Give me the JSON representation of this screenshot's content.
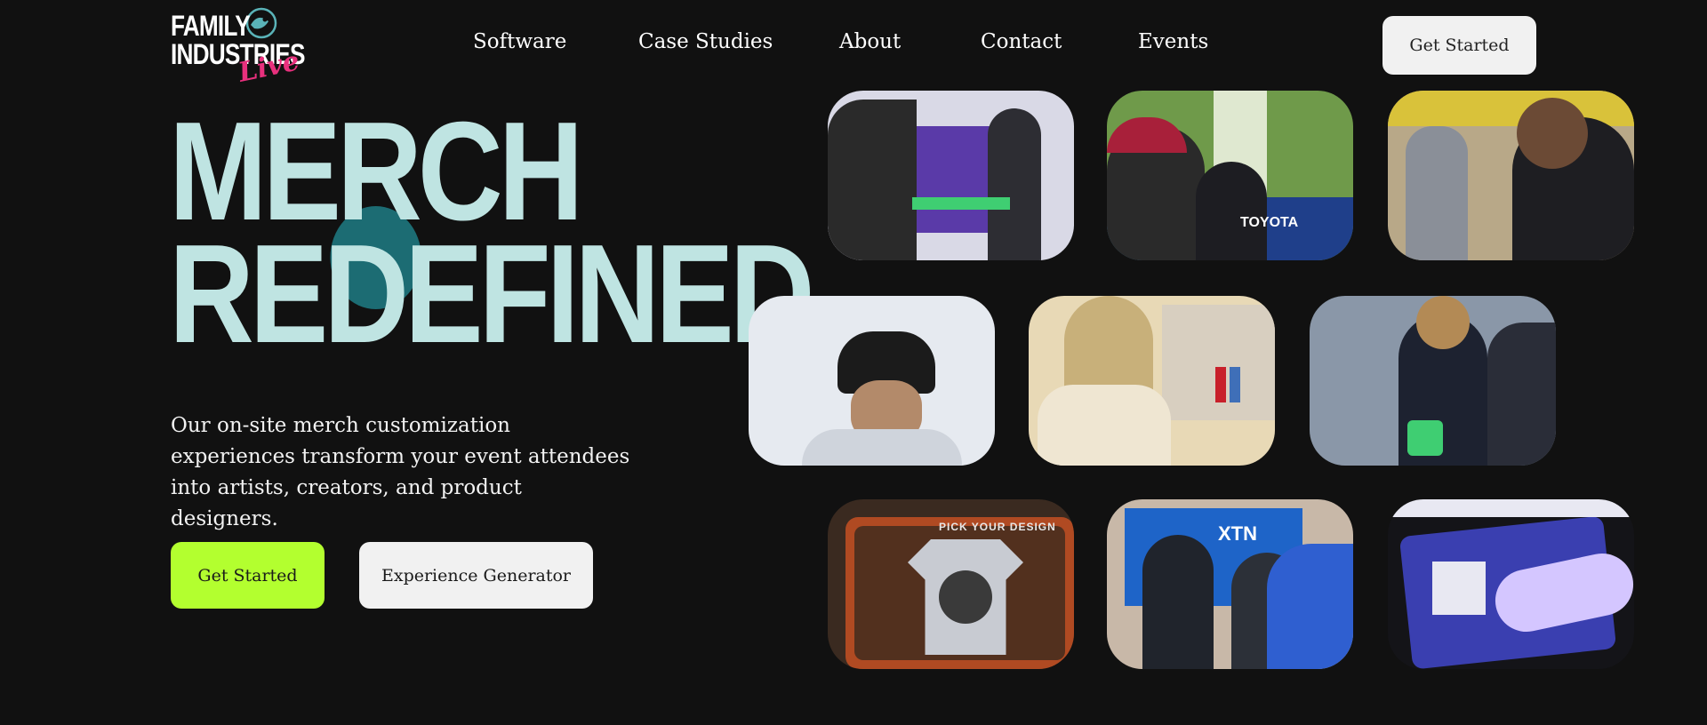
{
  "brand": {
    "logo_line1": "FAMILY",
    "logo_line2": "INDUSTRIES",
    "logo_script": "Live",
    "accent_pink": "#e8307d",
    "accent_lime": "#b3ff2f",
    "accent_teal": "#bfe4e2"
  },
  "nav": {
    "items": [
      {
        "label": "Software"
      },
      {
        "label": "Case Studies"
      },
      {
        "label": "About"
      },
      {
        "label": "Contact"
      },
      {
        "label": "Events"
      }
    ],
    "cta_label": "Get Started"
  },
  "hero": {
    "title_line1": "MERCH",
    "title_line2": "REDEFINED",
    "description": "Our on-site merch customization experiences transform your event attendees into artists, creators, and product designers.",
    "primary_button": "Get Started",
    "secondary_button": "Experience Generator"
  },
  "gallery": {
    "tiles": [
      {
        "name": "tile-event-booth-purple",
        "colors": [
          "#d9d9e6",
          "#5a3aa8",
          "#2a2a2a"
        ]
      },
      {
        "name": "tile-outdoor-toyota",
        "colors": [
          "#6f9a4a",
          "#1f3f8a",
          "#2a2a2a"
        ],
        "text": "TOYOTA"
      },
      {
        "name": "tile-smiling-attendee",
        "colors": [
          "#b8a888",
          "#3b3b45",
          "#1e1e22"
        ]
      },
      {
        "name": "tile-bucket-hat",
        "colors": [
          "#e6eaf0",
          "#1b1b1b",
          "#cfd4dc"
        ]
      },
      {
        "name": "tile-embroidery-station",
        "colors": [
          "#e8d9b6",
          "#c8b07a",
          "#3f6fb8"
        ]
      },
      {
        "name": "tile-convention-floor",
        "colors": [
          "#8a97a8",
          "#1d2230",
          "#4b6070"
        ]
      },
      {
        "name": "tile-tablet-design",
        "colors": [
          "#3a2a20",
          "#c8cbd2",
          "#b04a22"
        ],
        "text": "PICK YOUR DESIGN"
      },
      {
        "name": "tile-expo-hall",
        "colors": [
          "#1e64c8",
          "#20242c",
          "#c8b8a8"
        ],
        "text": "XTN"
      },
      {
        "name": "tile-touchscreen-hand",
        "colors": [
          "#3a3fb0",
          "#141418",
          "#d4c6ff"
        ]
      }
    ]
  }
}
